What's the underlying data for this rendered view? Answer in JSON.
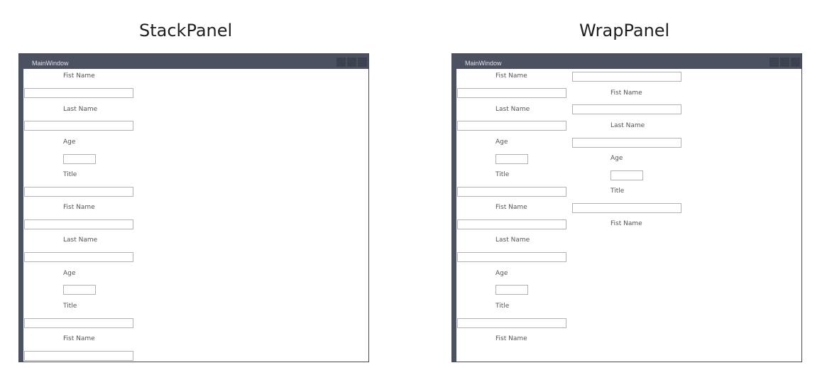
{
  "headings": {
    "left": "StackPanel",
    "right": "WrapPanel"
  },
  "window": {
    "title": "MainWindow"
  },
  "labels": {
    "first_name": "Fist Name",
    "last_name": "Last Name",
    "age": "Age",
    "title": "Title"
  }
}
